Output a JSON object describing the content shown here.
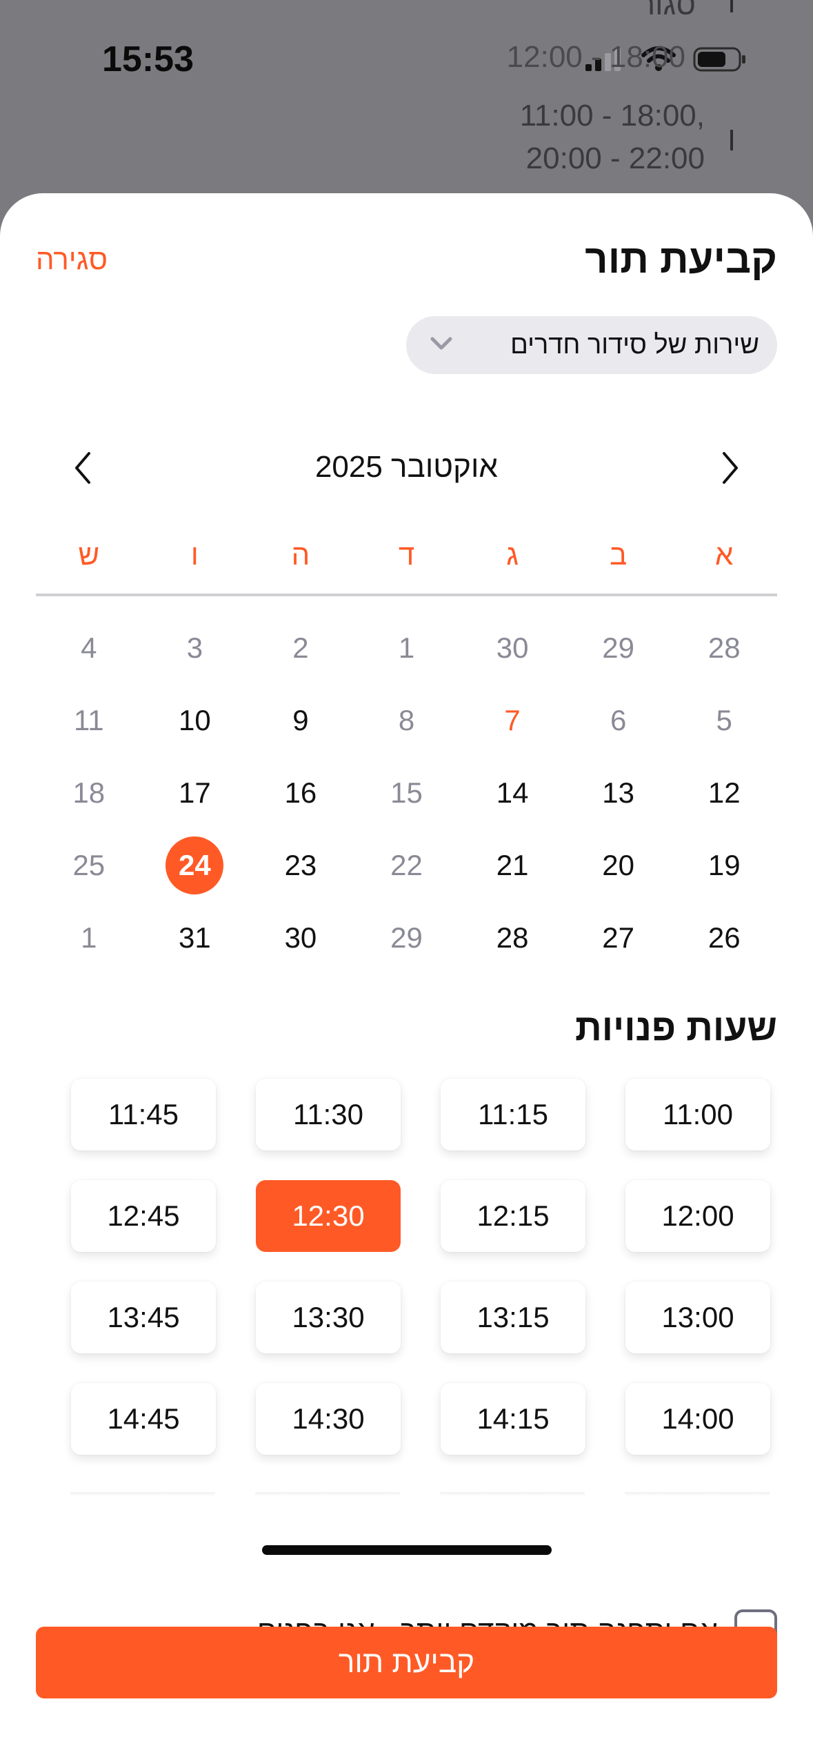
{
  "status_bar": {
    "time": "15:53"
  },
  "background": {
    "row_top": "סגור",
    "row_hours_1": "12:00 - 18:00",
    "row_hours_2a": "11:00 - 18:00,",
    "row_hours_2b": "20:00 - 22:00"
  },
  "sheet": {
    "title": "קביעת תור",
    "close_label": "סגירה",
    "service_selected": "שירות של סידור חדרים"
  },
  "calendar": {
    "month_label": "אוקטובר 2025",
    "weekdays": [
      "א",
      "ב",
      "ג",
      "ד",
      "ה",
      "ו",
      "ש"
    ],
    "weeks": [
      [
        {
          "d": "28",
          "s": "muted"
        },
        {
          "d": "29",
          "s": "muted"
        },
        {
          "d": "30",
          "s": "muted"
        },
        {
          "d": "1",
          "s": "muted"
        },
        {
          "d": "2",
          "s": "muted"
        },
        {
          "d": "3",
          "s": "muted"
        },
        {
          "d": "4",
          "s": "muted"
        }
      ],
      [
        {
          "d": "5",
          "s": "muted"
        },
        {
          "d": "6",
          "s": "muted"
        },
        {
          "d": "7",
          "s": "today"
        },
        {
          "d": "8",
          "s": "muted"
        },
        {
          "d": "9",
          "s": "avail"
        },
        {
          "d": "10",
          "s": "avail"
        },
        {
          "d": "11",
          "s": "muted"
        }
      ],
      [
        {
          "d": "12",
          "s": "avail"
        },
        {
          "d": "13",
          "s": "avail"
        },
        {
          "d": "14",
          "s": "avail"
        },
        {
          "d": "15",
          "s": "muted"
        },
        {
          "d": "16",
          "s": "avail"
        },
        {
          "d": "17",
          "s": "avail"
        },
        {
          "d": "18",
          "s": "muted"
        }
      ],
      [
        {
          "d": "19",
          "s": "avail"
        },
        {
          "d": "20",
          "s": "avail"
        },
        {
          "d": "21",
          "s": "avail"
        },
        {
          "d": "22",
          "s": "muted"
        },
        {
          "d": "23",
          "s": "avail"
        },
        {
          "d": "24",
          "s": "selected"
        },
        {
          "d": "25",
          "s": "muted"
        }
      ],
      [
        {
          "d": "26",
          "s": "avail"
        },
        {
          "d": "27",
          "s": "avail"
        },
        {
          "d": "28",
          "s": "avail"
        },
        {
          "d": "29",
          "s": "muted"
        },
        {
          "d": "30",
          "s": "avail"
        },
        {
          "d": "31",
          "s": "avail"
        },
        {
          "d": "1",
          "s": "muted"
        }
      ]
    ]
  },
  "slots": {
    "title": "שעות פנויות",
    "items": [
      {
        "t": "11:00",
        "sel": false
      },
      {
        "t": "11:15",
        "sel": false
      },
      {
        "t": "11:30",
        "sel": false
      },
      {
        "t": "11:45",
        "sel": false
      },
      {
        "t": "12:00",
        "sel": false
      },
      {
        "t": "12:15",
        "sel": false
      },
      {
        "t": "12:30",
        "sel": true
      },
      {
        "t": "12:45",
        "sel": false
      },
      {
        "t": "13:00",
        "sel": false
      },
      {
        "t": "13:15",
        "sel": false
      },
      {
        "t": "13:30",
        "sel": false
      },
      {
        "t": "13:45",
        "sel": false
      },
      {
        "t": "14:00",
        "sel": false
      },
      {
        "t": "14:15",
        "sel": false
      },
      {
        "t": "14:30",
        "sel": false
      },
      {
        "t": "14:45",
        "sel": false
      }
    ]
  },
  "notify": {
    "label": "אם יתפנה  תור מוקדם יותר - אני בפנים",
    "checked": false
  },
  "submit": {
    "label": "קביעת תור"
  },
  "colors": {
    "accent": "#ff5a26",
    "muted_day": "#8a8a96",
    "select_bg": "#e9e9ee"
  }
}
